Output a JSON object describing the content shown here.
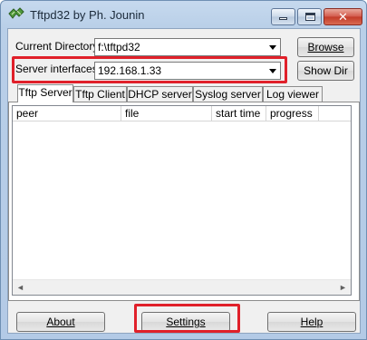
{
  "window": {
    "title": "Tftpd32 by Ph. Jounin",
    "icon": "tftpd-app-icon",
    "caption_buttons": {
      "minimize": "minimize-icon",
      "maximize": "maximize-icon",
      "close": "✕"
    }
  },
  "current_directory": {
    "label": "Current Directory",
    "value": "f:\\tftpd32",
    "browse_label": "Browse"
  },
  "server_interfaces": {
    "label": "Server interfaces",
    "value": "192.168.1.33",
    "show_dir_label": "Show Dir"
  },
  "tabs": [
    {
      "label": "Tftp Server",
      "active": true
    },
    {
      "label": "Tftp Client",
      "active": false
    },
    {
      "label": "DHCP server",
      "active": false
    },
    {
      "label": "Syslog server",
      "active": false
    },
    {
      "label": "Log viewer",
      "active": false
    }
  ],
  "table": {
    "columns": [
      "peer",
      "file",
      "start time",
      "progress"
    ],
    "rows": []
  },
  "scrollbar": {
    "left_arrow": "◄",
    "right_arrow": "►"
  },
  "footer": {
    "about_label": "About",
    "settings_label": "Settings",
    "help_label": "Help"
  },
  "highlight_color": "#e0202a"
}
